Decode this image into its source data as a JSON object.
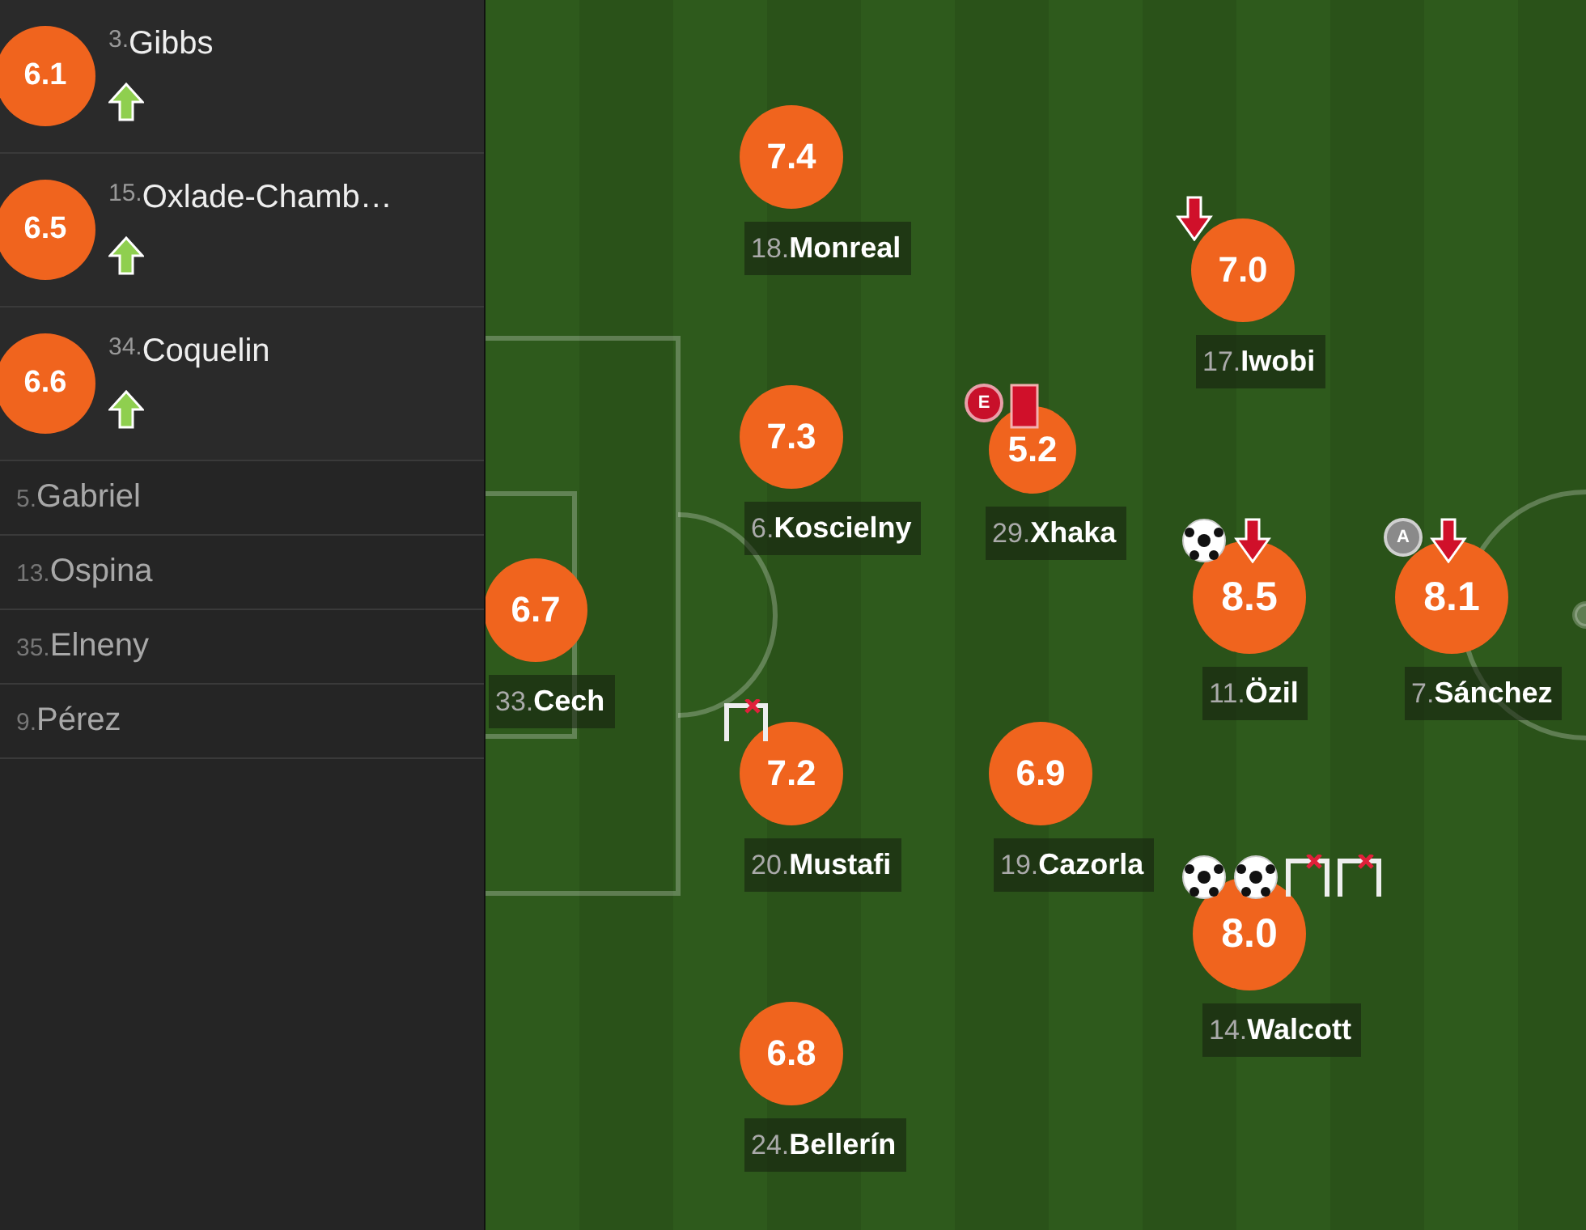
{
  "substitutes": [
    {
      "rating": "6.1",
      "number": "3.",
      "name": "Gibbs",
      "subbed_on": true
    },
    {
      "rating": "6.5",
      "number": "15.",
      "name": "Oxlade-Chamb…",
      "subbed_on": true
    },
    {
      "rating": "6.6",
      "number": "34.",
      "name": "Coquelin",
      "subbed_on": true
    }
  ],
  "bench": [
    {
      "number": "5.",
      "name": "Gabriel"
    },
    {
      "number": "13.",
      "name": "Ospina"
    },
    {
      "number": "35.",
      "name": "Elneny"
    },
    {
      "number": "9.",
      "name": "Pérez"
    }
  ],
  "players": [
    {
      "rating": "7.4",
      "number": "18.",
      "name": "Monreal"
    },
    {
      "rating": "7.0",
      "number": "17.",
      "name": "Iwobi",
      "events": [
        {
          "kind": "sub-off"
        }
      ]
    },
    {
      "rating": "7.3",
      "number": "6.",
      "name": "Koscielny"
    },
    {
      "rating": "5.2",
      "number": "29.",
      "name": "Xhaka",
      "events": [
        {
          "kind": "error",
          "label": "E"
        },
        {
          "kind": "red-card"
        }
      ]
    },
    {
      "rating": "6.7",
      "number": "33.",
      "name": "Cech"
    },
    {
      "rating": "8.5",
      "number": "11.",
      "name": "Özil",
      "events": [
        {
          "kind": "goal"
        },
        {
          "kind": "sub-off"
        }
      ]
    },
    {
      "rating": "8.1",
      "number": "7.",
      "name": "Sánchez",
      "events": [
        {
          "kind": "assist",
          "label": "A"
        },
        {
          "kind": "sub-off"
        }
      ]
    },
    {
      "rating": "7.2",
      "number": "20.",
      "name": "Mustafi",
      "events": [
        {
          "kind": "woodwork"
        }
      ]
    },
    {
      "rating": "6.9",
      "number": "19.",
      "name": "Cazorla"
    },
    {
      "rating": "8.0",
      "number": "14.",
      "name": "Walcott",
      "events": [
        {
          "kind": "goal"
        },
        {
          "kind": "goal"
        },
        {
          "kind": "woodwork"
        },
        {
          "kind": "woodwork"
        }
      ]
    },
    {
      "rating": "6.8",
      "number": "24.",
      "name": "Bellerín"
    }
  ]
}
